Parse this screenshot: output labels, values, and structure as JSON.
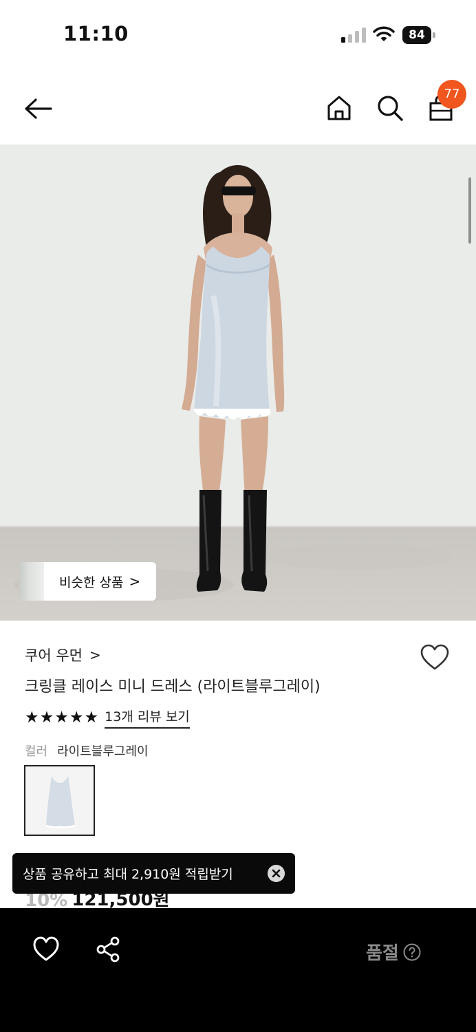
{
  "status_bar": {
    "time": "11:10",
    "battery": "84",
    "icons": [
      "signal-icon",
      "wifi-icon",
      "battery-icon"
    ]
  },
  "header": {
    "icons": [
      "back-arrow-icon",
      "home-icon",
      "search-icon",
      "shopping-bag-icon"
    ],
    "cart_count": "77",
    "badge_color": "#f0561d"
  },
  "hero": {
    "similar_label": "비슷한 상품",
    "similar_chevron": ">"
  },
  "product": {
    "brand": "쿠어 우먼",
    "brand_chevron": ">",
    "title": "크링클 레이스 미니 드레스 (라이트블루그레이)",
    "rating_stars": 5,
    "stars": [
      "★",
      "★",
      "★",
      "★",
      "★"
    ],
    "review_link": "13개 리뷰 보기",
    "color_label": "컬러",
    "color_value": "라이트블루그레이",
    "discount": "10%",
    "price": "121,500원"
  },
  "toast": {
    "message": "상품 공유하고 최대 2,910원 적립받기",
    "close_icon": "close-circle-icon"
  },
  "bottom_bar": {
    "icons": [
      "heart-icon",
      "share-icon",
      "help-circle-icon"
    ],
    "soldout_label": "품절",
    "background": "#000000"
  }
}
